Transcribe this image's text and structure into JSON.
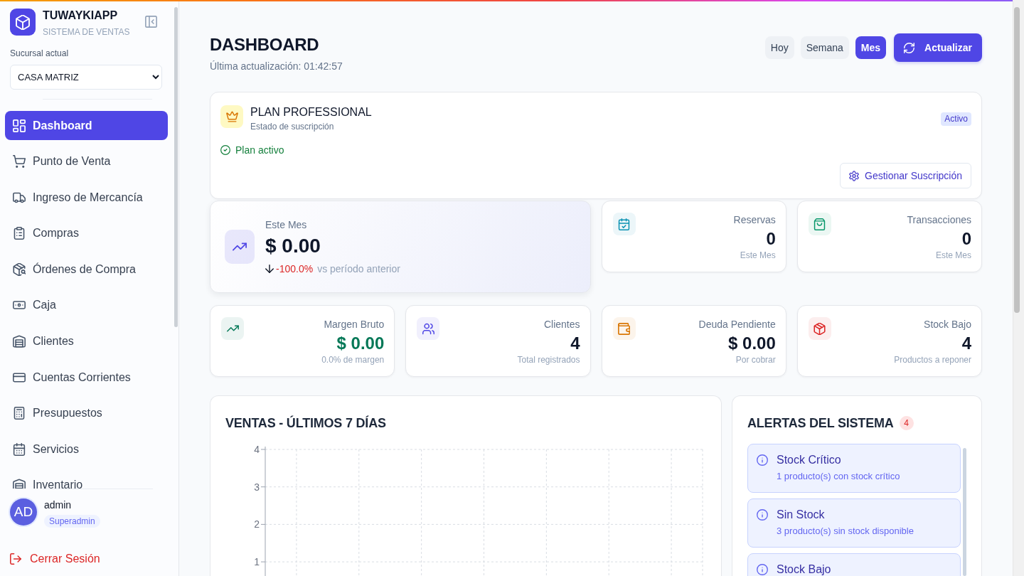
{
  "sidebar": {
    "brand": {
      "name": "TUWAYKIAPP",
      "tagline": "SISTEMA DE VENTAS"
    },
    "branch": {
      "label": "Sucursal actual",
      "value": "CASA MATRIZ"
    },
    "items": [
      {
        "label": "Dashboard",
        "selected": true
      },
      {
        "label": "Punto de Venta",
        "selected": false
      },
      {
        "label": "Ingreso de Mercancía",
        "selected": false
      },
      {
        "label": "Compras",
        "selected": false
      },
      {
        "label": "Órdenes de Compra",
        "selected": false
      },
      {
        "label": "Caja",
        "selected": false
      },
      {
        "label": "Clientes",
        "selected": false
      },
      {
        "label": "Cuentas Corrientes",
        "selected": false
      },
      {
        "label": "Presupuestos",
        "selected": false
      },
      {
        "label": "Servicios",
        "selected": false
      },
      {
        "label": "Inventario",
        "selected": false
      }
    ],
    "user": {
      "initials": "AD",
      "name": "admin",
      "role": "Superadmin"
    },
    "logout": "Cerrar Sesión"
  },
  "header": {
    "title": "DASHBOARD",
    "updated": "Última actualización: 01:42:57",
    "periods": [
      {
        "label": "Hoy",
        "selected": false
      },
      {
        "label": "Semana",
        "selected": false
      },
      {
        "label": "Mes",
        "selected": true
      }
    ],
    "refresh": "Actualizar"
  },
  "plan": {
    "name": "PLAN PROFESSIONAL",
    "caption": "Estado de suscripción",
    "badge": "Activo",
    "status": "Plan activo",
    "active": true,
    "manage": "Gestionar Suscripción"
  },
  "stats": [
    {
      "kind": "hero",
      "label": "Este Mes",
      "value": "$ 0.00",
      "color": "#4f46e5",
      "accent_value": false,
      "change": {
        "negative": true,
        "value": "-100.0%",
        "text": "vs período anterior"
      }
    },
    {
      "kind": "card",
      "label": "Reservas",
      "value": "0",
      "caption": "Este Mes",
      "color": "#0891b2",
      "accent_value": false
    },
    {
      "kind": "card",
      "label": "Transacciones",
      "value": "0",
      "caption": "Este Mes",
      "color": "#059669",
      "accent_value": false
    },
    {
      "kind": "card",
      "label": "Margen Bruto",
      "value": "$ 0.00",
      "caption": "0.0% de margen",
      "color": "#047857",
      "accent_value": true
    },
    {
      "kind": "card",
      "label": "Clientes",
      "value": "4",
      "caption": "Total registrados",
      "color": "#4f46e5",
      "accent_value": false
    },
    {
      "kind": "card",
      "label": "Deuda Pendiente",
      "value": "$ 0.00",
      "caption": "Por cobrar",
      "color": "#d97706",
      "accent_value": false
    },
    {
      "kind": "card",
      "label": "Stock Bajo",
      "value": "4",
      "caption": "Productos a reponer",
      "color": "#dc2626",
      "accent_value": false
    }
  ],
  "sales_chart": {
    "chart_data": {
      "type": "line",
      "title": "VENTAS - ÚLTIMOS 7 DÍAS",
      "categories": [
        null,
        null,
        null,
        null,
        null,
        null,
        null
      ],
      "ylim": [
        0,
        4
      ],
      "yticks": [
        {
          "value": 1,
          "label": "1"
        },
        {
          "value": 2,
          "label": "2"
        },
        {
          "value": 3,
          "label": "3"
        },
        {
          "value": 4,
          "label": "4"
        }
      ],
      "grid": true
    }
  },
  "alerts": {
    "title": "ALERTAS DEL SISTEMA",
    "count": "4",
    "items": [
      {
        "title": "Stock Crítico",
        "description": "1 producto(s) con stock crítico"
      },
      {
        "title": "Sin Stock",
        "description": "3 producto(s) sin stock disponible"
      },
      {
        "title": "Stock Bajo"
      }
    ]
  }
}
